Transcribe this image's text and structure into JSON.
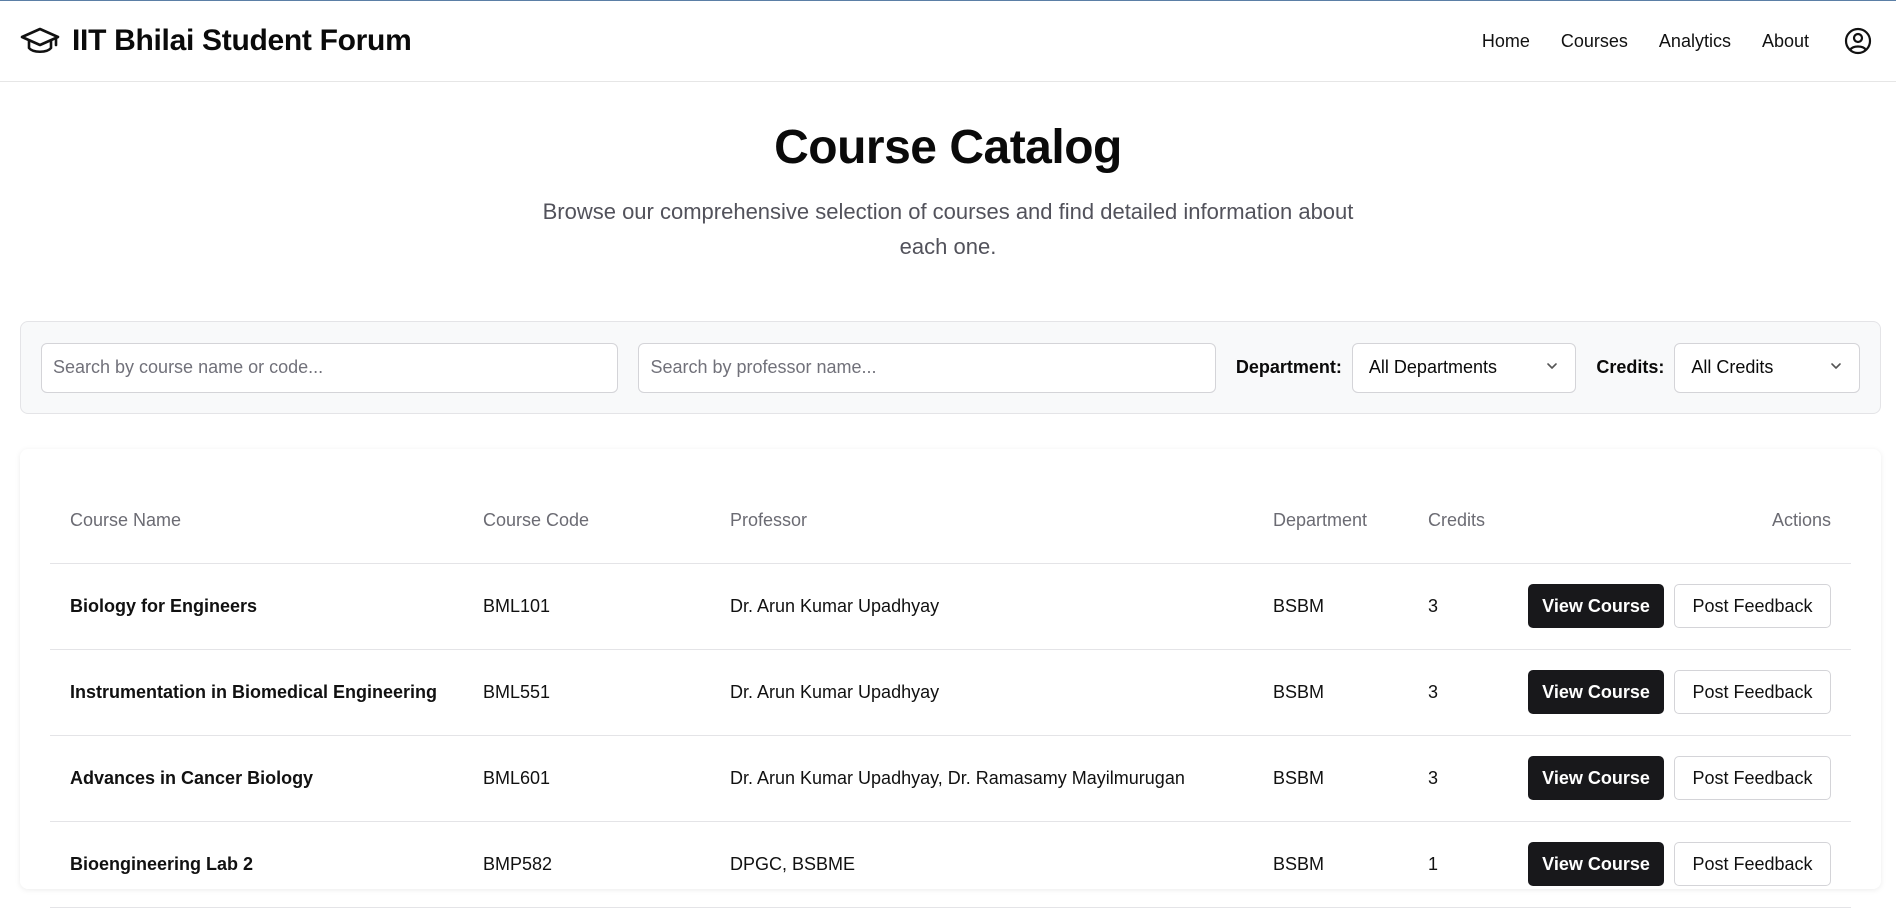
{
  "header": {
    "brand_icon": "graduation-cap-icon",
    "title": "IIT Bhilai Student Forum",
    "nav": [
      "Home",
      "Courses",
      "Analytics",
      "About"
    ],
    "user_icon": "user-circle-icon"
  },
  "hero": {
    "title": "Course Catalog",
    "subtitle": "Browse our comprehensive selection of courses and find detailed information about each one."
  },
  "filters": {
    "course_search_placeholder": "Search by course name or code...",
    "professor_search_placeholder": "Search by professor name...",
    "department_label": "Department:",
    "department_value": "All Departments",
    "credits_label": "Credits:",
    "credits_value": "All Credits"
  },
  "table": {
    "columns": [
      "Course Name",
      "Course Code",
      "Professor",
      "Department",
      "Credits",
      "Actions"
    ],
    "rows": [
      {
        "name": "Biology for Engineers",
        "code": "BML101",
        "professor": "Dr. Arun Kumar Upadhyay",
        "department": "BSBM",
        "credits": "3"
      },
      {
        "name": "Instrumentation in Biomedical Engineering",
        "code": "BML551",
        "professor": "Dr. Arun Kumar Upadhyay",
        "department": "BSBM",
        "credits": "3"
      },
      {
        "name": "Advances in Cancer Biology",
        "code": "BML601",
        "professor": "Dr. Arun Kumar Upadhyay, Dr. Ramasamy Mayilmurugan",
        "department": "BSBM",
        "credits": "3"
      },
      {
        "name": "Bioengineering Lab 2",
        "code": "BMP582",
        "professor": "DPGC, BSBME",
        "department": "BSBM",
        "credits": "1"
      }
    ],
    "view_label": "View Course",
    "feedback_label": "Post Feedback"
  },
  "colors": {
    "primary_button": "#18181b",
    "filter_background": "#f8f9fa",
    "muted_text": "#52525b"
  }
}
